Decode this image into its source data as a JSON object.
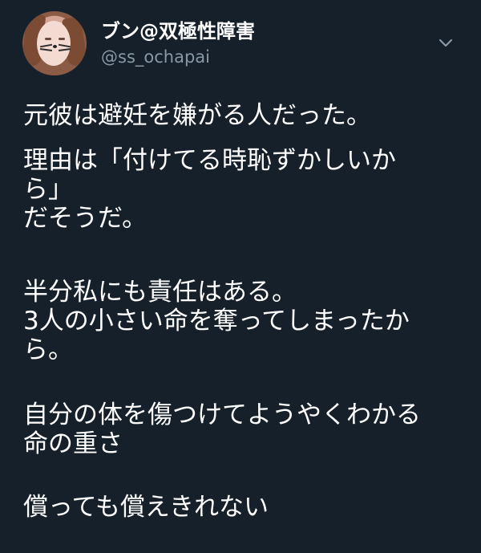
{
  "user": {
    "display_name": "ブン@双極性障害",
    "handle": "@ss_ochapai"
  },
  "tweet": {
    "paragraphs": [
      "元彼は避妊を嫌がる人だった。",
      "理由は「付けてる時恥ずかしいか",
      "ら」",
      "だそうだ。",
      "半分私にも責任はある。",
      "3人の小さい命を奪ってしまったか",
      "ら。",
      "自分の体を傷つけてようやくわかる",
      "命の重さ",
      "償っても償えきれない"
    ]
  },
  "icons": {
    "menu": "chevron-down-icon",
    "avatar": "avatar"
  },
  "colors": {
    "background": "#15202b",
    "primary_text": "#ffffff",
    "secondary_text": "#8899a6"
  }
}
